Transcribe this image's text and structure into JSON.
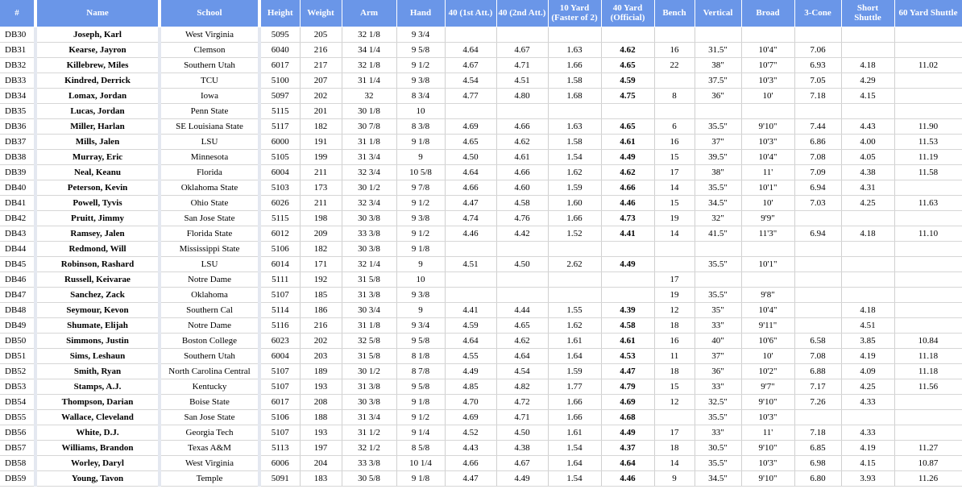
{
  "headers": [
    "#",
    "Name",
    "School",
    "Height",
    "Weight",
    "Arm",
    "Hand",
    "40 (1st Att.)",
    "40 (2nd Att.)",
    "10 Yard (Faster of 2)",
    "40 Yard (Official)",
    "Bench",
    "Vertical",
    "Broad",
    "3-Cone",
    "Short Shuttle",
    "60 Yard Shuttle"
  ],
  "rows": [
    [
      "DB30",
      "Joseph, Karl",
      "West Virginia",
      "5095",
      "205",
      "32 1/8",
      "9 3/4",
      "",
      "",
      "",
      "",
      "",
      "",
      "",
      "",
      "",
      ""
    ],
    [
      "DB31",
      "Kearse, Jayron",
      "Clemson",
      "6040",
      "216",
      "34 1/4",
      "9 5/8",
      "4.64",
      "4.67",
      "1.63",
      "4.62",
      "16",
      "31.5\"",
      "10'4\"",
      "7.06",
      "",
      ""
    ],
    [
      "DB32",
      "Killebrew, Miles",
      "Southern Utah",
      "6017",
      "217",
      "32 1/8",
      "9 1/2",
      "4.67",
      "4.71",
      "1.66",
      "4.65",
      "22",
      "38\"",
      "10'7\"",
      "6.93",
      "4.18",
      "11.02"
    ],
    [
      "DB33",
      "Kindred, Derrick",
      "TCU",
      "5100",
      "207",
      "31 1/4",
      "9 3/8",
      "4.54",
      "4.51",
      "1.58",
      "4.59",
      "",
      "37.5\"",
      "10'3\"",
      "7.05",
      "4.29",
      ""
    ],
    [
      "DB34",
      "Lomax, Jordan",
      "Iowa",
      "5097",
      "202",
      "32",
      "8 3/4",
      "4.77",
      "4.80",
      "1.68",
      "4.75",
      "8",
      "36\"",
      "10'",
      "7.18",
      "4.15",
      ""
    ],
    [
      "DB35",
      "Lucas, Jordan",
      "Penn State",
      "5115",
      "201",
      "30 1/8",
      "10",
      "",
      "",
      "",
      "",
      "",
      "",
      "",
      "",
      "",
      ""
    ],
    [
      "DB36",
      "Miller, Harlan",
      "SE Louisiana State",
      "5117",
      "182",
      "30 7/8",
      "8 3/8",
      "4.69",
      "4.66",
      "1.63",
      "4.65",
      "6",
      "35.5\"",
      "9'10\"",
      "7.44",
      "4.43",
      "11.90"
    ],
    [
      "DB37",
      "Mills, Jalen",
      "LSU",
      "6000",
      "191",
      "31 1/8",
      "9 1/8",
      "4.65",
      "4.62",
      "1.58",
      "4.61",
      "16",
      "37\"",
      "10'3\"",
      "6.86",
      "4.00",
      "11.53"
    ],
    [
      "DB38",
      "Murray, Eric",
      "Minnesota",
      "5105",
      "199",
      "31 3/4",
      "9",
      "4.50",
      "4.61",
      "1.54",
      "4.49",
      "15",
      "39.5\"",
      "10'4\"",
      "7.08",
      "4.05",
      "11.19"
    ],
    [
      "DB39",
      "Neal, Keanu",
      "Florida",
      "6004",
      "211",
      "32 3/4",
      "10 5/8",
      "4.64",
      "4.66",
      "1.62",
      "4.62",
      "17",
      "38\"",
      "11'",
      "7.09",
      "4.38",
      "11.58"
    ],
    [
      "DB40",
      "Peterson, Kevin",
      "Oklahoma State",
      "5103",
      "173",
      "30 1/2",
      "9 7/8",
      "4.66",
      "4.60",
      "1.59",
      "4.66",
      "14",
      "35.5\"",
      "10'1\"",
      "6.94",
      "4.31",
      ""
    ],
    [
      "DB41",
      "Powell, Tyvis",
      "Ohio State",
      "6026",
      "211",
      "32 3/4",
      "9 1/2",
      "4.47",
      "4.58",
      "1.60",
      "4.46",
      "15",
      "34.5\"",
      "10'",
      "7.03",
      "4.25",
      "11.63"
    ],
    [
      "DB42",
      "Pruitt, Jimmy",
      "San Jose State",
      "5115",
      "198",
      "30 3/8",
      "9 3/8",
      "4.74",
      "4.76",
      "1.66",
      "4.73",
      "19",
      "32\"",
      "9'9\"",
      "",
      "",
      ""
    ],
    [
      "DB43",
      "Ramsey, Jalen",
      "Florida State",
      "6012",
      "209",
      "33 3/8",
      "9 1/2",
      "4.46",
      "4.42",
      "1.52",
      "4.41",
      "14",
      "41.5\"",
      "11'3\"",
      "6.94",
      "4.18",
      "11.10"
    ],
    [
      "DB44",
      "Redmond, Will",
      "Mississippi State",
      "5106",
      "182",
      "30 3/8",
      "9 1/8",
      "",
      "",
      "",
      "",
      "",
      "",
      "",
      "",
      "",
      ""
    ],
    [
      "DB45",
      "Robinson, Rashard",
      "LSU",
      "6014",
      "171",
      "32 1/4",
      "9",
      "4.51",
      "4.50",
      "2.62",
      "4.49",
      "",
      "35.5\"",
      "10'1\"",
      "",
      "",
      ""
    ],
    [
      "DB46",
      "Russell, Keivarae",
      "Notre Dame",
      "5111",
      "192",
      "31 5/8",
      "10",
      "",
      "",
      "",
      "",
      "17",
      "",
      "",
      "",
      "",
      ""
    ],
    [
      "DB47",
      "Sanchez, Zack",
      "Oklahoma",
      "5107",
      "185",
      "31 3/8",
      "9 3/8",
      "",
      "",
      "",
      "",
      "19",
      "35.5\"",
      "9'8\"",
      "",
      "",
      ""
    ],
    [
      "DB48",
      "Seymour, Kevon",
      "Southern Cal",
      "5114",
      "186",
      "30 3/4",
      "9",
      "4.41",
      "4.44",
      "1.55",
      "4.39",
      "12",
      "35\"",
      "10'4\"",
      "",
      "4.18",
      ""
    ],
    [
      "DB49",
      "Shumate, Elijah",
      "Notre Dame",
      "5116",
      "216",
      "31 1/8",
      "9 3/4",
      "4.59",
      "4.65",
      "1.62",
      "4.58",
      "18",
      "33\"",
      "9'11\"",
      "",
      "4.51",
      ""
    ],
    [
      "DB50",
      "Simmons, Justin",
      "Boston College",
      "6023",
      "202",
      "32 5/8",
      "9 5/8",
      "4.64",
      "4.62",
      "1.61",
      "4.61",
      "16",
      "40\"",
      "10'6\"",
      "6.58",
      "3.85",
      "10.84"
    ],
    [
      "DB51",
      "Sims, Leshaun",
      "Southern Utah",
      "6004",
      "203",
      "31 5/8",
      "8 1/8",
      "4.55",
      "4.64",
      "1.64",
      "4.53",
      "11",
      "37\"",
      "10'",
      "7.08",
      "4.19",
      "11.18"
    ],
    [
      "DB52",
      "Smith, Ryan",
      "North Carolina Central",
      "5107",
      "189",
      "30 1/2",
      "8 7/8",
      "4.49",
      "4.54",
      "1.59",
      "4.47",
      "18",
      "36\"",
      "10'2\"",
      "6.88",
      "4.09",
      "11.18"
    ],
    [
      "DB53",
      "Stamps, A.J.",
      "Kentucky",
      "5107",
      "193",
      "31 3/8",
      "9 5/8",
      "4.85",
      "4.82",
      "1.77",
      "4.79",
      "15",
      "33\"",
      "9'7\"",
      "7.17",
      "4.25",
      "11.56"
    ],
    [
      "DB54",
      "Thompson, Darian",
      "Boise State",
      "6017",
      "208",
      "30 3/8",
      "9 1/8",
      "4.70",
      "4.72",
      "1.66",
      "4.69",
      "12",
      "32.5\"",
      "9'10\"",
      "7.26",
      "4.33",
      ""
    ],
    [
      "DB55",
      "Wallace, Cleveland",
      "San Jose State",
      "5106",
      "188",
      "31 3/4",
      "9 1/2",
      "4.69",
      "4.71",
      "1.66",
      "4.68",
      "",
      "35.5\"",
      "10'3\"",
      "",
      "",
      ""
    ],
    [
      "DB56",
      "White, D.J.",
      "Georgia Tech",
      "5107",
      "193",
      "31 1/2",
      "9 1/4",
      "4.52",
      "4.50",
      "1.61",
      "4.49",
      "17",
      "33\"",
      "11'",
      "7.18",
      "4.33",
      ""
    ],
    [
      "DB57",
      "Williams, Brandon",
      "Texas A&M",
      "5113",
      "197",
      "32 1/2",
      "8 5/8",
      "4.43",
      "4.38",
      "1.54",
      "4.37",
      "18",
      "30.5\"",
      "9'10\"",
      "6.85",
      "4.19",
      "11.27"
    ],
    [
      "DB58",
      "Worley, Daryl",
      "West Virginia",
      "6006",
      "204",
      "33 3/8",
      "10 1/4",
      "4.66",
      "4.67",
      "1.64",
      "4.64",
      "14",
      "35.5\"",
      "10'3\"",
      "6.98",
      "4.15",
      "10.87"
    ],
    [
      "DB59",
      "Young, Tavon",
      "Temple",
      "5091",
      "183",
      "30 5/8",
      "9 1/8",
      "4.47",
      "4.49",
      "1.54",
      "4.46",
      "9",
      "34.5\"",
      "9'10\"",
      "6.80",
      "3.93",
      "11.26"
    ]
  ]
}
